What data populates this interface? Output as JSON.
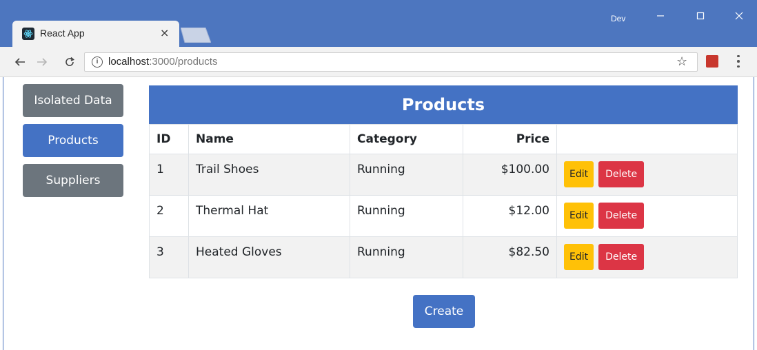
{
  "browser": {
    "tab_title": "React App",
    "tab_close": "×",
    "profile_name": "Dev",
    "url_host": "localhost",
    "url_rest": ":3000/products",
    "info_icon": "i"
  },
  "sidebar": {
    "items": [
      {
        "label": "Isolated Data",
        "color": "#6c757d"
      },
      {
        "label": "Products",
        "color": "#4472c4"
      },
      {
        "label": "Suppliers",
        "color": "#6c757d"
      }
    ]
  },
  "table": {
    "title": "Products",
    "headers": [
      "ID",
      "Name",
      "Category",
      "Price"
    ],
    "rows": [
      {
        "id": "1",
        "name": "Trail Shoes",
        "category": "Running",
        "price": "$100.00"
      },
      {
        "id": "2",
        "name": "Thermal Hat",
        "category": "Running",
        "price": "$12.00"
      },
      {
        "id": "3",
        "name": "Heated Gloves",
        "category": "Running",
        "price": "$82.50"
      }
    ],
    "edit_label": "Edit",
    "delete_label": "Delete"
  },
  "create_label": "Create",
  "colors": {
    "primary": "#4472c4",
    "secondary": "#6c757d",
    "warning": "#ffc107",
    "danger": "#dc3545",
    "titlebar": "#4d76bf"
  }
}
